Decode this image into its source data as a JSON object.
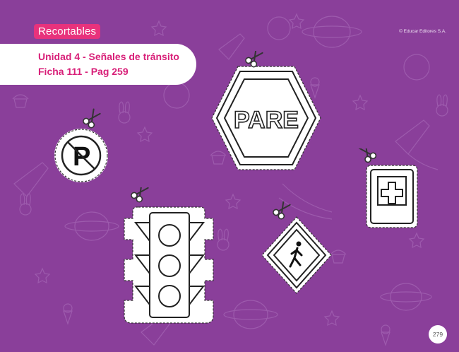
{
  "header": {
    "section_tag": "Recortables",
    "copyright": "© Educar Editores S.A."
  },
  "title": {
    "line1": "Unidad 4 - Señales de tránsito",
    "line2": "Ficha 111 - Pag 259"
  },
  "signs": {
    "stop_text": "PARE",
    "no_parking_letter": "P"
  },
  "footer": {
    "page_number": "279"
  },
  "colors": {
    "background": "#8a3f9a",
    "accent_pink": "#d81f78",
    "tag_pink": "#e8327c"
  },
  "icons": [
    "scissors-icon",
    "no-parking-sign",
    "stop-sign",
    "first-aid-sign",
    "traffic-light-sign",
    "pedestrian-crossing-sign"
  ]
}
